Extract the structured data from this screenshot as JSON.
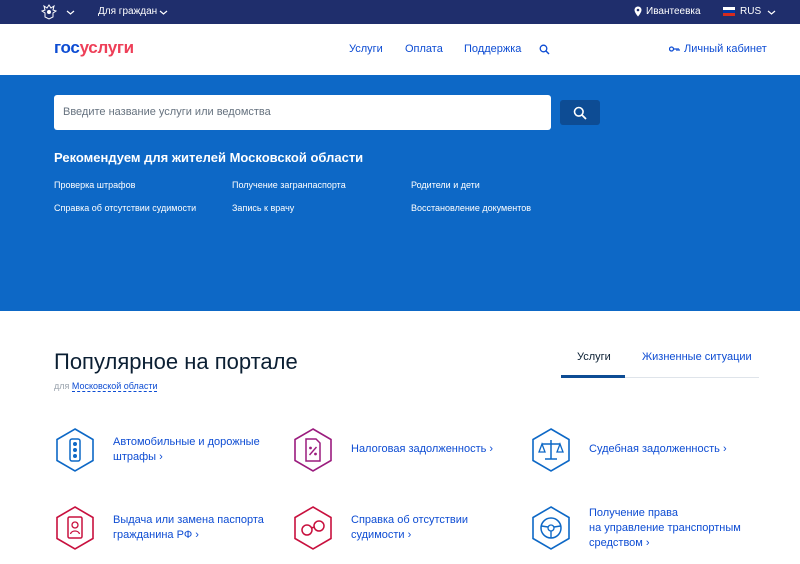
{
  "topbar": {
    "audience": "Для граждан",
    "location": "Ивантеевка",
    "language": "RUS",
    "flag_colors": [
      "#ffffff",
      "#0039a6",
      "#d52b1e"
    ]
  },
  "header": {
    "logo_part1": "гос",
    "logo_part2": "услуги",
    "nav": [
      "Услуги",
      "Оплата",
      "Поддержка"
    ],
    "account": "Личный кабинет"
  },
  "hero": {
    "search_placeholder": "Введите название услуги или ведомства",
    "recommend_title": "Рекомендуем для жителей Московской области",
    "links": [
      "Проверка штрафов",
      "Получение загранпаспорта",
      "Родители и дети",
      "Справка об отсутствии судимости",
      "Запись к врачу",
      "Восстановление документов"
    ]
  },
  "popular": {
    "title": "Популярное на портале",
    "for": "для",
    "region": "Московской области",
    "tabs": [
      "Услуги",
      "Жизненные ситуации"
    ],
    "items": [
      {
        "line1": "Автомобильные и дорожные",
        "line2": "штрафы ›",
        "line3": "",
        "icon": "traffic-light-icon",
        "color": "#0d68c6"
      },
      {
        "line1": "Налоговая задолженность ›",
        "line2": "",
        "line3": "",
        "icon": "tax-document-icon",
        "color": "#9b1c7e"
      },
      {
        "line1": "Судебная задолженность ›",
        "line2": "",
        "line3": "",
        "icon": "scales-icon",
        "color": "#0d68c6"
      },
      {
        "line1": "Выдача или замена паспорта",
        "line2": "гражданина РФ ›",
        "line3": "",
        "icon": "passport-icon",
        "color": "#c8103e"
      },
      {
        "line1": "Справка об отсутствии",
        "line2": "судимости ›",
        "line3": "",
        "icon": "handcuffs-icon",
        "color": "#c8103e"
      },
      {
        "line1": "Получение права",
        "line2": "на управление транспортным",
        "line3": "средством ›",
        "icon": "steering-wheel-icon",
        "color": "#0d68c6"
      }
    ]
  },
  "colors": {
    "brand_blue": "#0d4cd3",
    "hero_blue": "#0d68c6",
    "topbar": "#1f2e6c",
    "brand_red": "#ee3f58"
  }
}
